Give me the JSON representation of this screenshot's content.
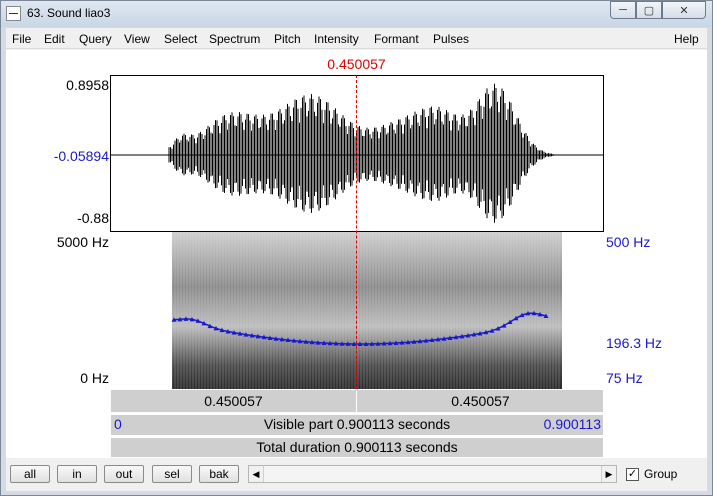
{
  "window": {
    "title": "63. Sound liao3"
  },
  "window_controls": {
    "minimize": "─",
    "maximize": "▢",
    "close": "✕"
  },
  "menu": [
    "File",
    "Edit",
    "Query",
    "View",
    "Select",
    "Spectrum",
    "Pitch",
    "Intensity",
    "Formant",
    "Pulses",
    "Help"
  ],
  "cursor": {
    "time_label": "0.450057",
    "fraction": 0.5
  },
  "waveform": {
    "y_max": "0.8958",
    "y_cursor": "-0.05894",
    "y_min": "-0.88"
  },
  "spectrogram": {
    "freq_top": "5000 Hz",
    "freq_bottom": "0 Hz",
    "pitch_top": "500 Hz",
    "pitch_value": "196.3 Hz",
    "pitch_bottom": "75 Hz"
  },
  "selection_bar": {
    "left": "0.450057",
    "right": "0.450057"
  },
  "visible_bar": {
    "start": "0",
    "text": "Visible part 0.900113 seconds",
    "end": "0.900113"
  },
  "total_bar": {
    "text": "Total duration 0.900113 seconds"
  },
  "nav_buttons": {
    "all": "all",
    "in": "in",
    "out": "out",
    "sel": "sel",
    "bak": "bak"
  },
  "scroll_arrows": {
    "left": "◀",
    "right": "▶"
  },
  "group": {
    "label": "Group",
    "checked": true,
    "mark": "✓"
  },
  "colors": {
    "cursor": "#e00000",
    "pitch": "#1a1acd",
    "spectrogram_dark": "#1f1f1f"
  }
}
